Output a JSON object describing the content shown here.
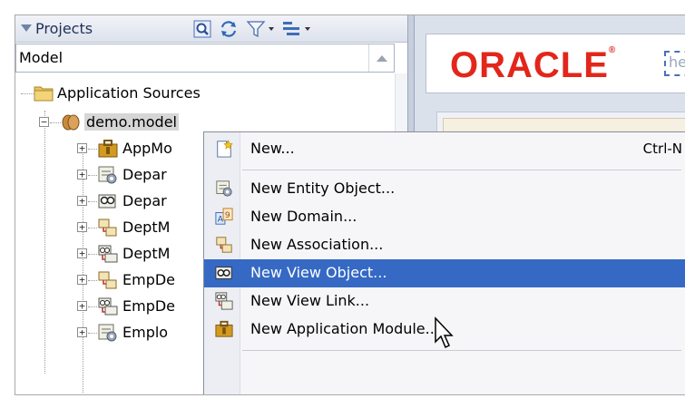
{
  "projects_panel": {
    "title": "Projects",
    "project_selector": "Model",
    "toolbar_icons": [
      "find-icon",
      "sync-icon",
      "filter-icon",
      "options-icon"
    ]
  },
  "tree": [
    {
      "label": "Application Sources",
      "icon": "folder-icon",
      "expander": ""
    },
    {
      "label": "demo.model",
      "icon": "package-icon",
      "expander": "−"
    },
    {
      "label": "AppMo",
      "icon": "application-module-icon",
      "expander": "+"
    },
    {
      "label": "Depar",
      "icon": "entity-object-icon",
      "expander": "+"
    },
    {
      "label": "Depar",
      "icon": "view-object-icon",
      "expander": "+"
    },
    {
      "label": "DeptM",
      "icon": "association-icon",
      "expander": "+"
    },
    {
      "label": "DeptM",
      "icon": "view-link-icon",
      "expander": "+"
    },
    {
      "label": "EmpDe",
      "icon": "association-icon",
      "expander": "+"
    },
    {
      "label": "EmpDe",
      "icon": "view-link-icon",
      "expander": "+"
    },
    {
      "label": "Emplo",
      "icon": "entity-object-icon",
      "expander": "+"
    }
  ],
  "editor": {
    "logo_text": "ORACLE",
    "logo_mark": "®",
    "field_text": "he"
  },
  "context_menu": {
    "items": [
      {
        "label": "New...",
        "shortcut": "Ctrl-N",
        "icon": "new-file-icon"
      },
      {
        "label": "New Entity Object...",
        "shortcut": "",
        "icon": "entity-object-icon"
      },
      {
        "label": "New Domain...",
        "shortcut": "",
        "icon": "domain-icon"
      },
      {
        "label": "New Association...",
        "shortcut": "",
        "icon": "association-icon"
      },
      {
        "label": "New View Object...",
        "shortcut": "",
        "icon": "view-object-icon",
        "highlighted": true
      },
      {
        "label": "New View Link...",
        "shortcut": "",
        "icon": "view-link-icon"
      },
      {
        "label": "New Application Module...",
        "shortcut": "",
        "icon": "application-module-icon"
      }
    ]
  },
  "colors": {
    "menu_highlight": "#3569c4",
    "oracle_red": "#e3261b",
    "panel_header": "#dde2ec"
  }
}
